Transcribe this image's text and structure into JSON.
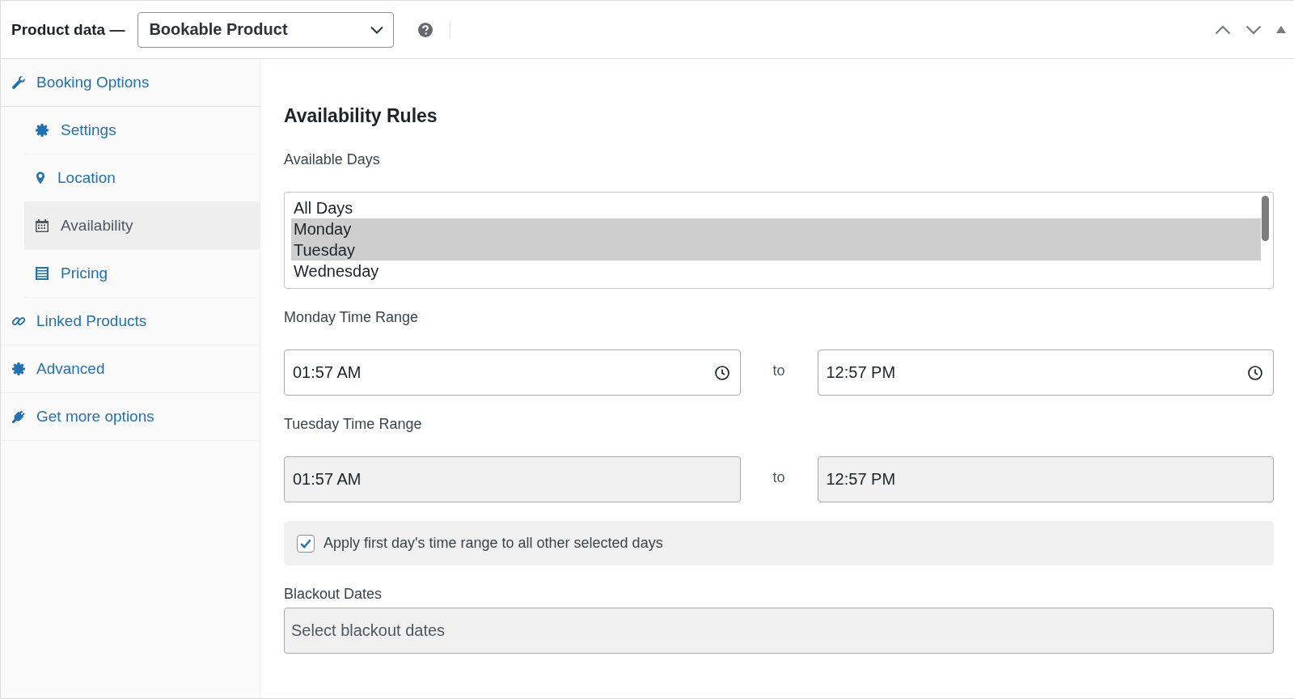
{
  "header": {
    "title": "Product data —",
    "product_type": {
      "value": "Bookable Product"
    }
  },
  "sidebar": {
    "items": [
      {
        "label": "Booking Options",
        "selected": false,
        "children": [
          {
            "label": "Settings",
            "selected": false
          },
          {
            "label": "Location",
            "selected": false
          },
          {
            "label": "Availability",
            "selected": true
          },
          {
            "label": "Pricing",
            "selected": false
          }
        ]
      },
      {
        "label": "Linked Products",
        "selected": false
      },
      {
        "label": "Advanced",
        "selected": false
      },
      {
        "label": "Get more options",
        "selected": false
      }
    ]
  },
  "availability": {
    "title": "Availability Rules",
    "available_days": {
      "label": "Available Days",
      "options": [
        {
          "label": "All Days",
          "selected": false
        },
        {
          "label": "Monday",
          "selected": true
        },
        {
          "label": "Tuesday",
          "selected": true
        },
        {
          "label": "Wednesday",
          "selected": false
        }
      ]
    },
    "time_ranges": [
      {
        "label": "Monday Time Range",
        "from": "01:57 AM",
        "separator": "to",
        "to": "12:57 PM",
        "disabled": false
      },
      {
        "label": "Tuesday Time Range",
        "from": "01:57 AM",
        "separator": "to",
        "to": "12:57 PM",
        "disabled": true
      }
    ],
    "apply_all": {
      "label": "Apply first day's time range to all other selected days",
      "checked": true
    },
    "blackout_dates": {
      "label": "Blackout Dates",
      "placeholder": "Select blackout dates"
    }
  }
}
